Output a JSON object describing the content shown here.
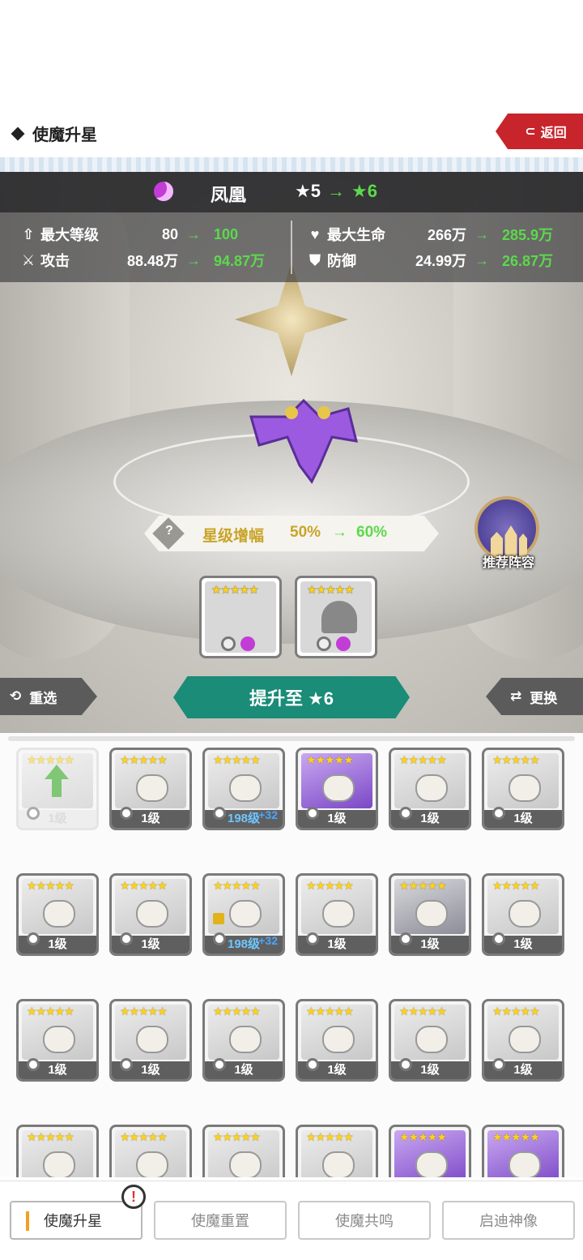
{
  "header": {
    "title": "使魔升星",
    "back_label": "返回"
  },
  "pet": {
    "name": "凤凰",
    "star_from": "★5",
    "star_to": "★6",
    "arrow": "→"
  },
  "stats": {
    "max_level": {
      "label": "最大等级",
      "old": "80",
      "new": "100"
    },
    "attack": {
      "label": "攻击",
      "old": "88.48万",
      "new": "94.87万"
    },
    "max_hp": {
      "label": "最大生命",
      "old": "266万",
      "new": "285.9万"
    },
    "defense": {
      "label": "防御",
      "old": "24.99万",
      "new": "26.87万"
    }
  },
  "boost": {
    "label": "星级增幅",
    "old": "50%",
    "new": "60%",
    "help": "?"
  },
  "recommend_label": "推荐阵容",
  "material_stars": "★★★★★",
  "buttons": {
    "reselect": "重选",
    "upgrade": "提升至 ★6",
    "swap": "更换"
  },
  "cards": [
    {
      "level": "1级",
      "selected": true
    },
    {
      "level": "1级"
    },
    {
      "level": "198级",
      "plus": "+32"
    },
    {
      "level": "1级",
      "purple": true
    },
    {
      "level": "1级"
    },
    {
      "level": "1级"
    },
    {
      "level": "1级"
    },
    {
      "level": "1级"
    },
    {
      "level": "198级",
      "plus": "+32",
      "lock": true
    },
    {
      "level": "1级"
    },
    {
      "level": "1级",
      "dark": true
    },
    {
      "level": "1级"
    },
    {
      "level": "1级"
    },
    {
      "level": "1级"
    },
    {
      "level": "1级"
    },
    {
      "level": "1级"
    },
    {
      "level": "1级"
    },
    {
      "level": "1级"
    },
    {
      "level": ""
    },
    {
      "level": ""
    },
    {
      "level": ""
    },
    {
      "level": ""
    },
    {
      "level": "",
      "purple": true
    },
    {
      "level": "",
      "purple": true
    }
  ],
  "tabs": [
    "使魔升星",
    "使魔重置",
    "使魔共鸣",
    "启迪神像"
  ],
  "alert_symbol": "!",
  "colors": {
    "accent_green": "#5cd94c",
    "upgrade_teal": "#1a8c77",
    "back_red": "#c8242b",
    "gold": "#c9a42a"
  }
}
